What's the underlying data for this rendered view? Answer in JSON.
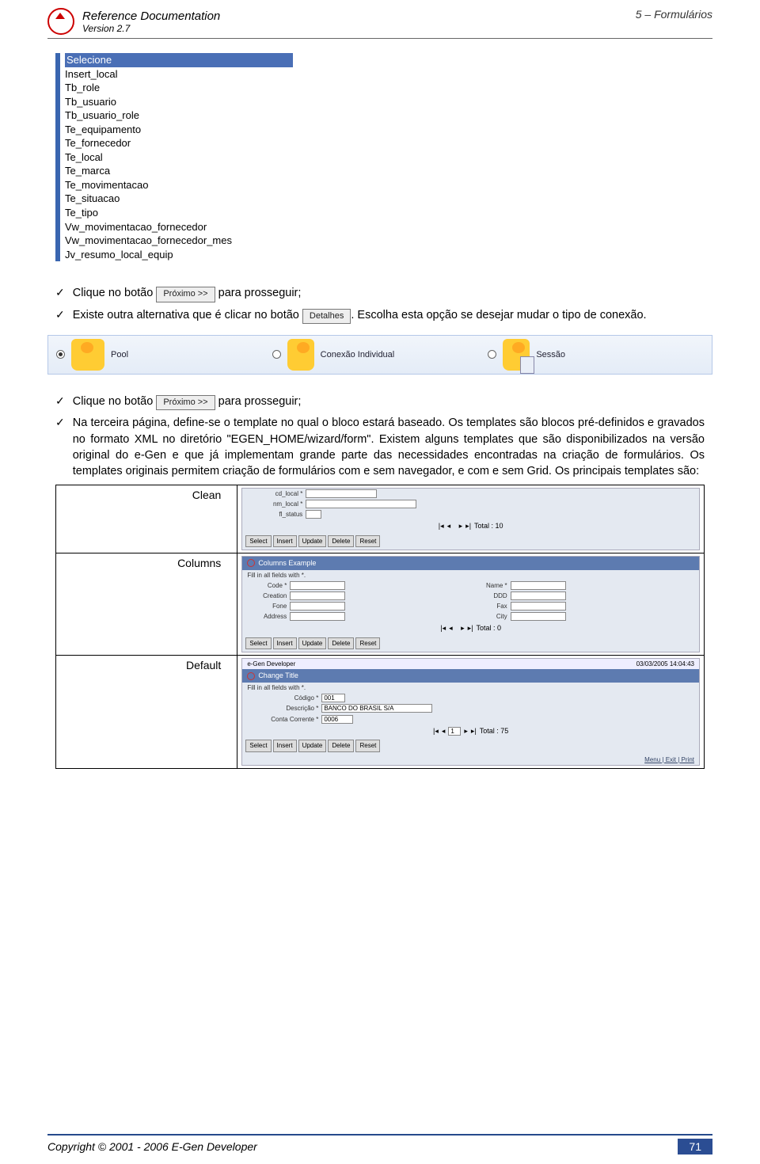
{
  "header": {
    "title": "Reference Documentation",
    "version": "Version 2.7",
    "section": "5 – Formulários"
  },
  "dropdown": {
    "items": [
      "Selecione",
      "Insert_local",
      "Tb_role",
      "Tb_usuario",
      "Tb_usuario_role",
      "Te_equipamento",
      "Te_fornecedor",
      "Te_local",
      "Te_marca",
      "Te_movimentacao",
      "Te_situacao",
      "Te_tipo",
      "Vw_movimentacao_fornecedor",
      "Vw_movimentacao_fornecedor_mes",
      "Jv_resumo_local_equip"
    ]
  },
  "buttons": {
    "proximo": "Próximo >>",
    "detalhes": "Detalhes"
  },
  "bullets": {
    "b1a": "Clique no botão",
    "b1b": "para prosseguir;",
    "b2a": "Existe outra alternativa que é clicar no botão",
    "b2b": ". Escolha esta opção se desejar mudar o tipo de conexão.",
    "b3a": "Clique no botão",
    "b3b": "para prosseguir;",
    "b4": "Na terceira página, define-se o template no qual o bloco estará baseado. Os templates são blocos pré-definidos e gravados no formato XML no diretório \"EGEN_HOME/wizard/form\". Existem alguns templates que são disponibilizados na versão original do e-Gen e que já implementam grande parte das necessidades encontradas na criação de formulários. Os templates originais permitem criação de formulários com e sem navegador, e com e sem Grid. Os principais templates são:"
  },
  "conn": {
    "pool": "Pool",
    "individual": "Conexão Individual",
    "sessao": "Sessão"
  },
  "templates": {
    "clean": "Clean",
    "columns": "Columns",
    "default": "Default"
  },
  "mini_clean": {
    "f1": "cd_local *",
    "f2": "nm_local *",
    "f3": "fl_status",
    "total": "Total : 10",
    "btns": [
      "Select",
      "Insert",
      "Update",
      "Delete",
      "Reset"
    ]
  },
  "mini_columns": {
    "title": "Columns Example",
    "fill": "Fill in all fields with *.",
    "left": [
      "Code *",
      "Creation",
      "Fone",
      "Address"
    ],
    "right": [
      "Name *",
      "DDD",
      "Fax",
      "City"
    ],
    "total": "Total : 0",
    "btns": [
      "Select",
      "Insert",
      "Update",
      "Delete",
      "Reset"
    ]
  },
  "mini_default": {
    "topleft": "e-Gen Developer",
    "topright": "03/03/2005 14:04:43",
    "title": "Change Title",
    "fill": "Fill in all fields with *.",
    "fields": [
      {
        "label": "Código *",
        "value": "001"
      },
      {
        "label": "Descrição *",
        "value": "BANCO DO BRASIL S/A"
      },
      {
        "label": "Conta Corrente *",
        "value": "0006"
      }
    ],
    "page": "1",
    "total": "Total : 75",
    "btns": [
      "Select",
      "Insert",
      "Update",
      "Delete",
      "Reset"
    ],
    "footer": "Menu | Exit | Print"
  },
  "footer": {
    "copyright": "Copyright © 2001 - 2006 E-Gen Developer",
    "page": "71"
  }
}
